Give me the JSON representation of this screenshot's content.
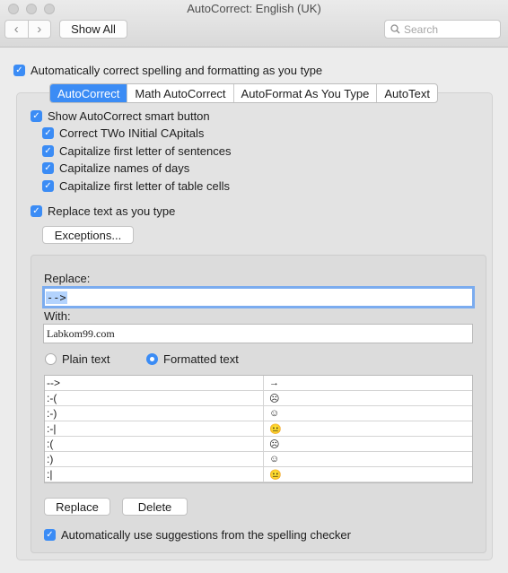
{
  "window": {
    "title": "AutoCorrect: English (UK)"
  },
  "toolbar": {
    "back_icon": "‹",
    "forward_icon": "›",
    "show_all": "Show All",
    "search_placeholder": "Search"
  },
  "main_option": {
    "label": "Automatically correct spelling and formatting as you type",
    "checked": true
  },
  "tabs": [
    "AutoCorrect",
    "Math AutoCorrect",
    "AutoFormat As You Type",
    "AutoText"
  ],
  "active_tab": "AutoCorrect",
  "autocorrect": {
    "smart_button": "Show AutoCorrect smart button",
    "options": [
      "Correct TWo INitial CApitals",
      "Capitalize first letter of sentences",
      "Capitalize names of days",
      "Capitalize first letter of table cells"
    ],
    "replace_text": "Replace text as you type",
    "exceptions_button": "Exceptions..."
  },
  "replace_section": {
    "replace_label": "Replace:",
    "replace_value": "-->",
    "with_label": "With:",
    "with_value": "Labkom99.com",
    "plain_text": "Plain text",
    "formatted_text": "Formatted text",
    "selected_format": "formatted"
  },
  "table": {
    "rows": [
      [
        "-->",
        "→"
      ],
      [
        ":-(",
        "☹"
      ],
      [
        ":-)",
        "☺"
      ],
      [
        ":-|",
        "😐"
      ],
      [
        ":(",
        "☹"
      ],
      [
        ":)",
        "☺"
      ],
      [
        ":|",
        "😐"
      ],
      [
        "",
        ""
      ]
    ]
  },
  "buttons": {
    "replace": "Replace",
    "delete": "Delete"
  },
  "spelling_option": "Automatically use suggestions from the spelling checker",
  "colors": {
    "accent": "#3b8cf5",
    "background": "#ececec",
    "focus_ring": "#7bacef"
  }
}
